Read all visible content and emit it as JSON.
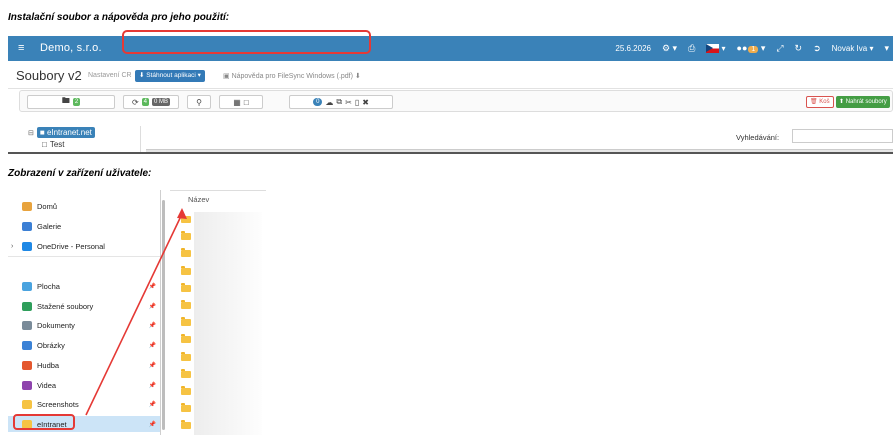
{
  "captions": {
    "install": "Instalační soubor a nápověda pro jeho použití:",
    "device": "Zobrazení v zařízení uživatele:"
  },
  "app": {
    "brand": "Demo, s.r.o.",
    "date": "25.6.2026",
    "notifications_count": "1",
    "user": "Novak Iva",
    "page_title": "Soubory v2",
    "settings_tab": "Nastavení CR",
    "download_button": "Stáhnout aplikaci",
    "help_link": "Nápověda pro FileSync Windows (.pdf)",
    "toolbar": {
      "folders_count": "2",
      "sync_count": "4",
      "size_badge": "0 MB",
      "selected_count": "0"
    },
    "delete_button": "Koš",
    "upload_button": "Nahrát soubory",
    "tree": {
      "root": "eIntranet.net",
      "child": "Test"
    },
    "search_label": "Vyhledávání:"
  },
  "explorer": {
    "column_name": "Název",
    "nav": [
      {
        "label": "Domů",
        "icon": "home-icon",
        "color": "#e8a33d"
      },
      {
        "label": "Galerie",
        "icon": "gallery-icon",
        "color": "#3b7fd4"
      },
      {
        "label": "OneDrive - Personal",
        "icon": "onedrive-icon",
        "color": "#1e88e5"
      },
      {
        "label": "Plocha",
        "icon": "desktop-icon",
        "color": "#4aa3df"
      },
      {
        "label": "Stažené soubory",
        "icon": "download-icon",
        "color": "#2e9e5b"
      },
      {
        "label": "Dokumenty",
        "icon": "documents-icon",
        "color": "#7a8b99"
      },
      {
        "label": "Obrázky",
        "icon": "pictures-icon",
        "color": "#3b82d6"
      },
      {
        "label": "Hudba",
        "icon": "music-icon",
        "color": "#e4572e"
      },
      {
        "label": "Videa",
        "icon": "videos-icon",
        "color": "#8e44ad"
      },
      {
        "label": "Screenshots",
        "icon": "folder-icon",
        "color": "#f6c343"
      },
      {
        "label": "eIntranet",
        "icon": "folder-icon",
        "color": "#f6c343"
      }
    ]
  }
}
